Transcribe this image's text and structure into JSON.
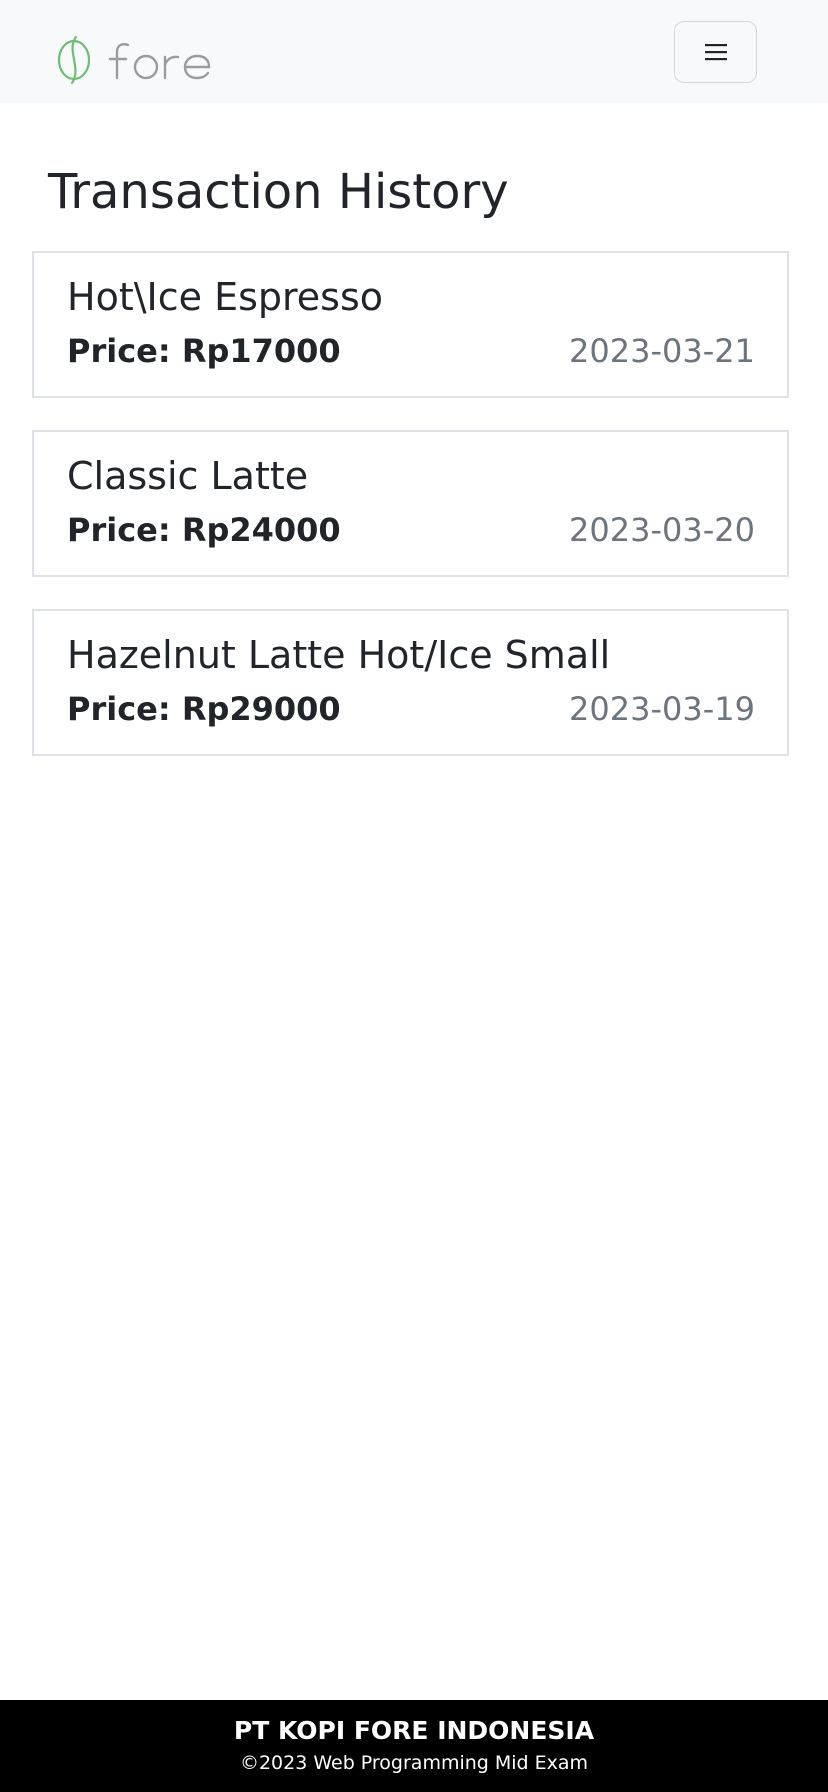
{
  "navbar": {
    "brand": "fore",
    "brand_color": "#6dbe73",
    "brand_text_color": "#9b9b9b",
    "menu_icon": "hamburger-icon"
  },
  "page": {
    "title": "Transaction History"
  },
  "transactions": [
    {
      "name": "Hot\\Ice Espresso",
      "price": "Price: Rp17000",
      "date": "2023-03-21"
    },
    {
      "name": "Classic Latte",
      "price": "Price: Rp24000",
      "date": "2023-03-20"
    },
    {
      "name": "Hazelnut Latte Hot/Ice Small",
      "price": "Price: Rp29000",
      "date": "2023-03-19"
    }
  ],
  "footer": {
    "company": "PT KOPI FORE INDONESIA",
    "copyright": "©2023 Web Programming Mid Exam"
  }
}
